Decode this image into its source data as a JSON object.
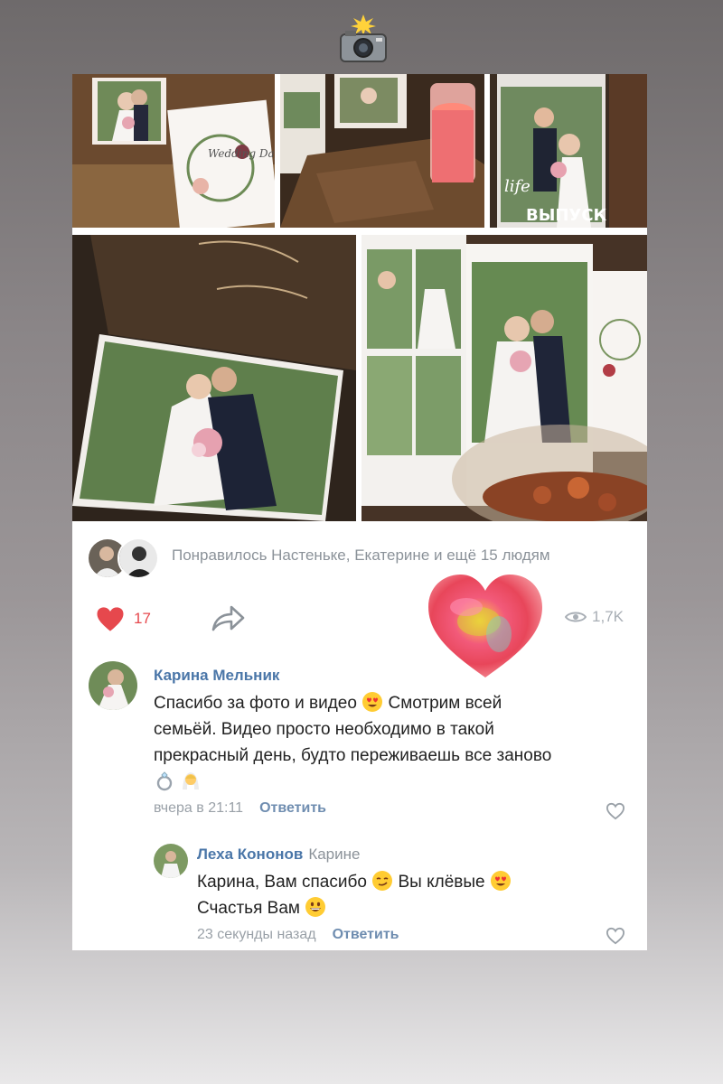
{
  "post": {
    "likes_text": "Понравилось Настеньке, Екатерине и ещё 15 людям",
    "like_count": "17",
    "views": "1,7K"
  },
  "comments": [
    {
      "author": "Карина Мельник",
      "text_line1": "Спасибо за фото и видео",
      "text_line1b": "Смотрим всей",
      "text_line2": "семьёй. Видео просто необходимо в такой",
      "text_line3": "прекрасный день, будто переживаешь все заново",
      "time": "вчера в 21:11",
      "reply_label": "Ответить"
    },
    {
      "author": "Леха Кононов",
      "reply_to": "Карине",
      "text_part1": "Карина, Вам спасибо",
      "text_part2": "Вы клёвые",
      "text_line2": "Счастья Вам",
      "time": "23 секунды назад",
      "reply_label": "Ответить"
    }
  ],
  "photo_texts": {
    "wedding_day": "Wedding Day",
    "magazine_issue": "ВЫПУСК",
    "magazine_title": "life"
  },
  "colors": {
    "accent_link": "#4a76a8",
    "like_red": "#e6484d",
    "muted": "#8b9299"
  },
  "icons": [
    "camera-flash-sticker",
    "heart-icon",
    "share-icon",
    "eye-icon",
    "heart-outline-icon",
    "heart-sticker",
    "ring-emoji",
    "bride-emoji",
    "heart-eyes-emoji",
    "smirk-emoji",
    "grin-emoji"
  ]
}
